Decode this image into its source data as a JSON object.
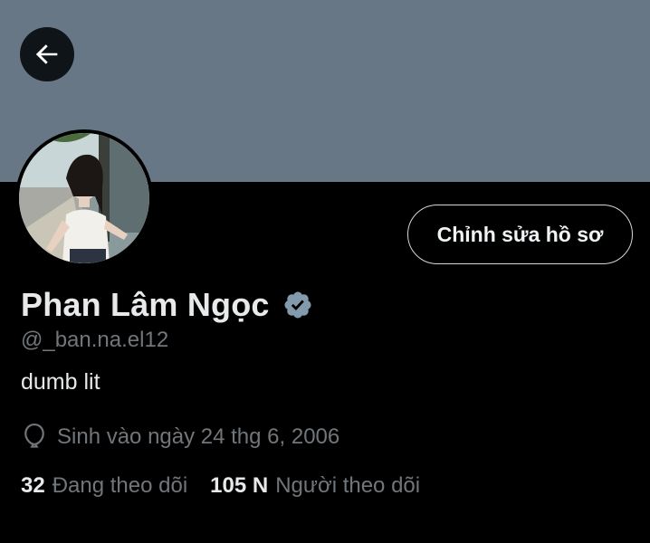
{
  "profile": {
    "display_name": "Phan Lâm Ngọc",
    "handle": "@_ban.na.el12",
    "bio": "dumb lit",
    "birthday": "Sinh vào ngày 24 thg 6, 2006",
    "verified": true
  },
  "actions": {
    "edit_profile_label": "Chỉnh sửa hồ sơ",
    "back_icon": "arrow-left-icon"
  },
  "stats": {
    "following_count": "32",
    "following_label": "Đang theo dõi",
    "followers_count": "105 N",
    "followers_label": "Người theo dõi"
  },
  "colors": {
    "background": "#000000",
    "banner": "#687785",
    "primary_text": "#e7e9ea",
    "secondary_text": "#71767b",
    "verified_badge": "#829aab",
    "button_border": "#cfd9de"
  }
}
